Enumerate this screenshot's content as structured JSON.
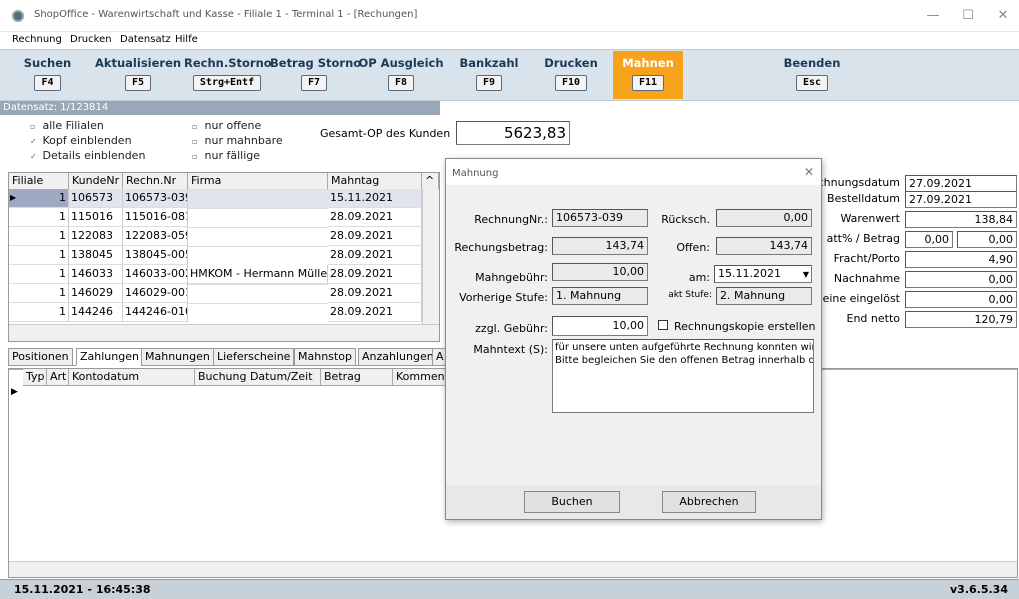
{
  "window": {
    "title": "ShopOffice - Warenwirtschaft und Kasse - Filiale 1 - Terminal 1 - [Rechungen]",
    "min": "—",
    "max": "☐",
    "close": "✕"
  },
  "menu": [
    "Rechnung",
    "Drucken",
    "Datensatz",
    "Hilfe"
  ],
  "toolbar": [
    {
      "label": "Suchen",
      "key": "F4"
    },
    {
      "label": "Aktualisieren",
      "key": "F5"
    },
    {
      "label": "Rechn.Storno",
      "key": "Strg+Entf"
    },
    {
      "label": "Betrag Storno",
      "key": "F7"
    },
    {
      "label": "OP Ausgleich",
      "key": "F8"
    },
    {
      "label": "Bankzahl",
      "key": "F9"
    },
    {
      "label": "Drucken",
      "key": "F10"
    },
    {
      "label": "Mahnen",
      "key": "F11"
    },
    {
      "label": "Beenden",
      "key": "Esc"
    }
  ],
  "datensatz": "Datensatz: 1/123814",
  "filters": {
    "alle_filialen": "alle Filialen",
    "kopf": "Kopf einblenden",
    "details": "Details einblenden",
    "nur_offene": "nur offene",
    "nur_mahnbare": "nur mahnbare",
    "nur_faellige": "nur fällige"
  },
  "gesamt_op": {
    "label": "Gesamt-OP des Kunden",
    "value": "5623,83"
  },
  "table": {
    "headers": [
      "Filiale",
      "KundeNr",
      "Rechn.Nr",
      "Firma",
      "Mahntag"
    ],
    "rows": [
      [
        "1",
        "106573",
        "106573-039",
        "",
        "15.11.2021"
      ],
      [
        "1",
        "115016",
        "115016-081",
        "",
        "28.09.2021"
      ],
      [
        "1",
        "122083",
        "122083-059",
        "",
        "28.09.2021"
      ],
      [
        "1",
        "138045",
        "138045-005",
        "",
        "28.09.2021"
      ],
      [
        "1",
        "146033",
        "146033-002",
        "HMKOM - Hermann Mülle",
        "28.09.2021"
      ],
      [
        "1",
        "146029",
        "146029-001",
        "",
        "28.09.2021"
      ],
      [
        "1",
        "144246",
        "144246-010",
        "",
        "28.09.2021"
      ]
    ]
  },
  "tabs": [
    "Positionen",
    "Zahlungen",
    "Mahnungen",
    "Lieferscheine",
    "Mahnstop",
    "Anzahlungen",
    "A"
  ],
  "lower_headers": [
    "Typ",
    "Art",
    "Kontodatum",
    "Buchung Datum/Zeit",
    "Betrag",
    "Komment"
  ],
  "right_panel": [
    {
      "label": "chnungsdatum",
      "value": "27.09.2021"
    },
    {
      "label": "Bestelldatum",
      "value": "27.09.2021"
    },
    {
      "label": "Warenwert",
      "value": "138,84"
    },
    {
      "label": "att% / Betrag",
      "value1": "0,00",
      "value": "0,00"
    },
    {
      "label": "Fracht/Porto",
      "value": "4,90"
    },
    {
      "label": "Nachnahme",
      "value": "0,00"
    },
    {
      "label": "eine eingelöst",
      "value": "0,00"
    },
    {
      "label": "End netto",
      "value": "120,79"
    }
  ],
  "dialog": {
    "title": "Mahnung",
    "rechnungnr_label": "RechnungNr.:",
    "rechnungnr": "106573-039",
    "rueck_label": "Rücksch.",
    "rueck": "0,00",
    "betrag_label": "Rechungsbetrag:",
    "betrag": "143,74",
    "offen_label": "Offen:",
    "offen": "143,74",
    "gebuehr_label": "Mahngebühr:",
    "gebuehr": "10,00",
    "am_label": "am:",
    "am": "15.11.2021",
    "vor_label": "Vorherige Stufe:",
    "vor": "1. Mahnung",
    "akt_label": "akt Stufe:",
    "akt": "2. Mahnung",
    "zzgl_label": "zzgl. Gebühr:",
    "zzgl": "10,00",
    "kopie_label": "Rechnungskopie erstellen",
    "mahntext_label": "Mahntext (S):",
    "mahntext_line1": "für unsere unten aufgeführte Rechnung konnten wir bis",
    "mahntext_line2": "Bitte begleichen Sie den offenen Betrag innerhalb der",
    "buchen": "Buchen",
    "abbrechen": "Abbrechen"
  },
  "status": {
    "datetime": "15.11.2021 - 16:45:38",
    "version": "v3.6.5.34"
  }
}
